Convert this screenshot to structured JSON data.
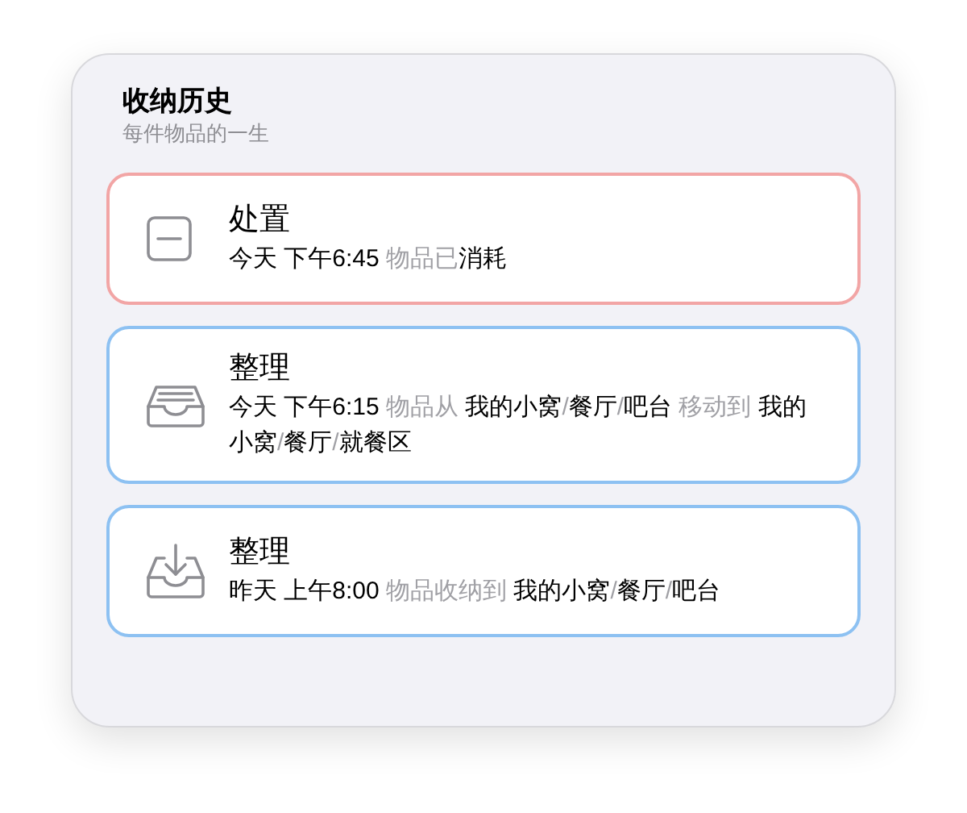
{
  "header": {
    "title": "收纳历史",
    "subtitle": "每件物品的一生"
  },
  "entries": [
    {
      "kind": "dispose",
      "color": "#f2a5a5",
      "title": "处置",
      "detail": [
        {
          "text": "今天 下午6:45",
          "muted": false
        },
        {
          "text": " 物品已",
          "muted": true
        },
        {
          "text": "消耗",
          "muted": false
        }
      ]
    },
    {
      "kind": "move",
      "color": "#8dc1f2",
      "title": "整理",
      "detail": [
        {
          "text": "今天 下午6:15",
          "muted": false
        },
        {
          "text": " 物品从 ",
          "muted": true
        },
        {
          "text": "我的小窝",
          "muted": false
        },
        {
          "text": "/",
          "muted": true
        },
        {
          "text": "餐厅",
          "muted": false
        },
        {
          "text": "/",
          "muted": true
        },
        {
          "text": "吧台",
          "muted": false
        },
        {
          "text": " 移动到 ",
          "muted": true
        },
        {
          "text": "我的小窝",
          "muted": false
        },
        {
          "text": "/",
          "muted": true
        },
        {
          "text": "餐厅",
          "muted": false
        },
        {
          "text": "/",
          "muted": true
        },
        {
          "text": "就餐区",
          "muted": false
        }
      ]
    },
    {
      "kind": "store",
      "color": "#8dc1f2",
      "title": "整理",
      "detail": [
        {
          "text": "昨天 上午8:00",
          "muted": false
        },
        {
          "text": " 物品收纳到 ",
          "muted": true
        },
        {
          "text": "我的小窝",
          "muted": false
        },
        {
          "text": "/",
          "muted": true
        },
        {
          "text": "餐厅",
          "muted": false
        },
        {
          "text": "/",
          "muted": true
        },
        {
          "text": "吧台",
          "muted": false
        }
      ]
    }
  ]
}
